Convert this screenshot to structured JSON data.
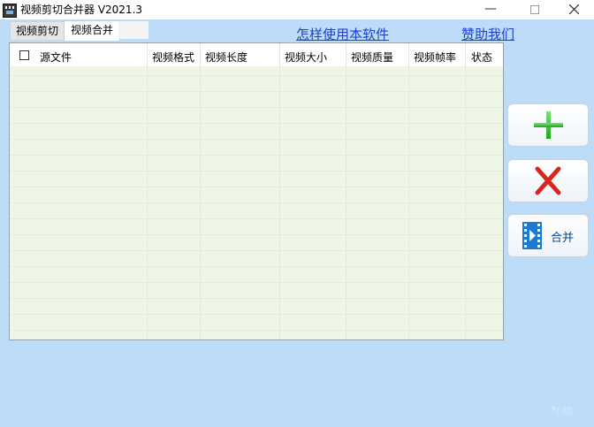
{
  "window": {
    "title": "视频剪切合并器 V2021.3"
  },
  "tabs": [
    {
      "label": "视频剪切"
    },
    {
      "label": "视频合并"
    }
  ],
  "links": {
    "howto": "怎样使用本软件",
    "donate": "赞助我们"
  },
  "table": {
    "columns": [
      "源文件",
      "视频格式",
      "视频长度",
      "视频大小",
      "视频质量",
      "视频帧率",
      "状态"
    ],
    "rows": []
  },
  "buttons": {
    "add_icon": "plus-icon",
    "remove_icon": "x-icon",
    "merge_label": "合并"
  },
  "watermark": "为 动",
  "colors": {
    "background": "#bcdcf7",
    "grid_background": "#eef7e6",
    "link": "#1a3fd0",
    "add_green": "#2bbf2b",
    "remove_red": "#d9261c",
    "merge_blue": "#1d7ad0"
  }
}
